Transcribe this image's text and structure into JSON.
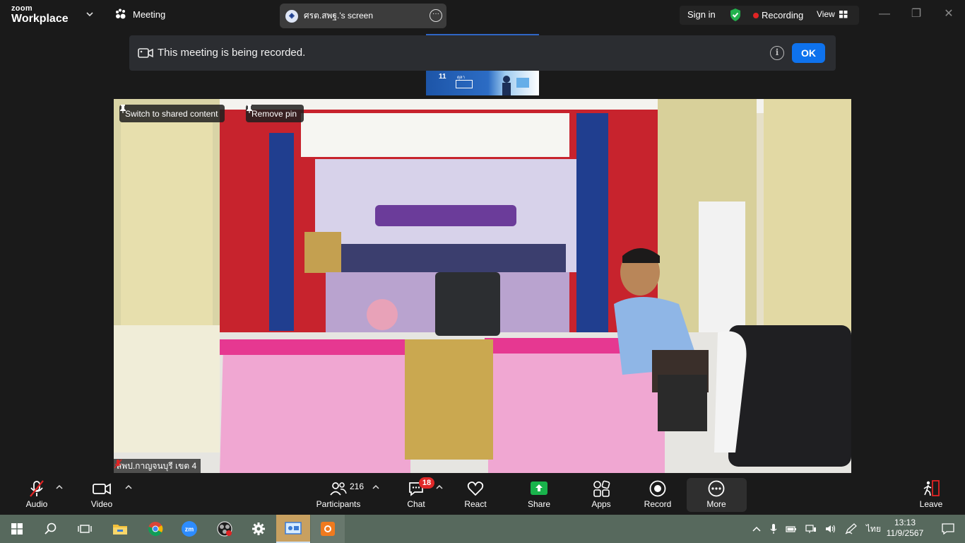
{
  "app": {
    "brand_line1": "zoom",
    "brand_line2": "Workplace",
    "meeting_label": "Meeting",
    "shared_tab_title": "ศรต.สพฐ.'s screen",
    "sign_in": "Sign in",
    "recording_label": "Recording",
    "view_label": "View"
  },
  "banner": {
    "message": "This meeting is being recorded.",
    "ok_label": "OK"
  },
  "thumbnail": {
    "day": "11",
    "text": "ตุลา"
  },
  "video": {
    "switch_label": "Switch to shared content",
    "remove_pin_label": "Remove pin",
    "participant_name": "สพป.กาญจนบุรี เขต 4"
  },
  "toolbar": {
    "audio": "Audio",
    "video": "Video",
    "participants": "Participants",
    "participants_count": "216",
    "chat": "Chat",
    "chat_badge": "18",
    "react": "React",
    "share": "Share",
    "apps": "Apps",
    "record": "Record",
    "more": "More",
    "leave": "Leave"
  },
  "taskbar": {
    "language": "ไทย",
    "time": "13:13",
    "date": "11/9/2567"
  },
  "colors": {
    "accent_blue": "#0e72ed",
    "share_green": "#19b34b",
    "recording_red": "#e02424",
    "secure_green": "#23b14d"
  }
}
